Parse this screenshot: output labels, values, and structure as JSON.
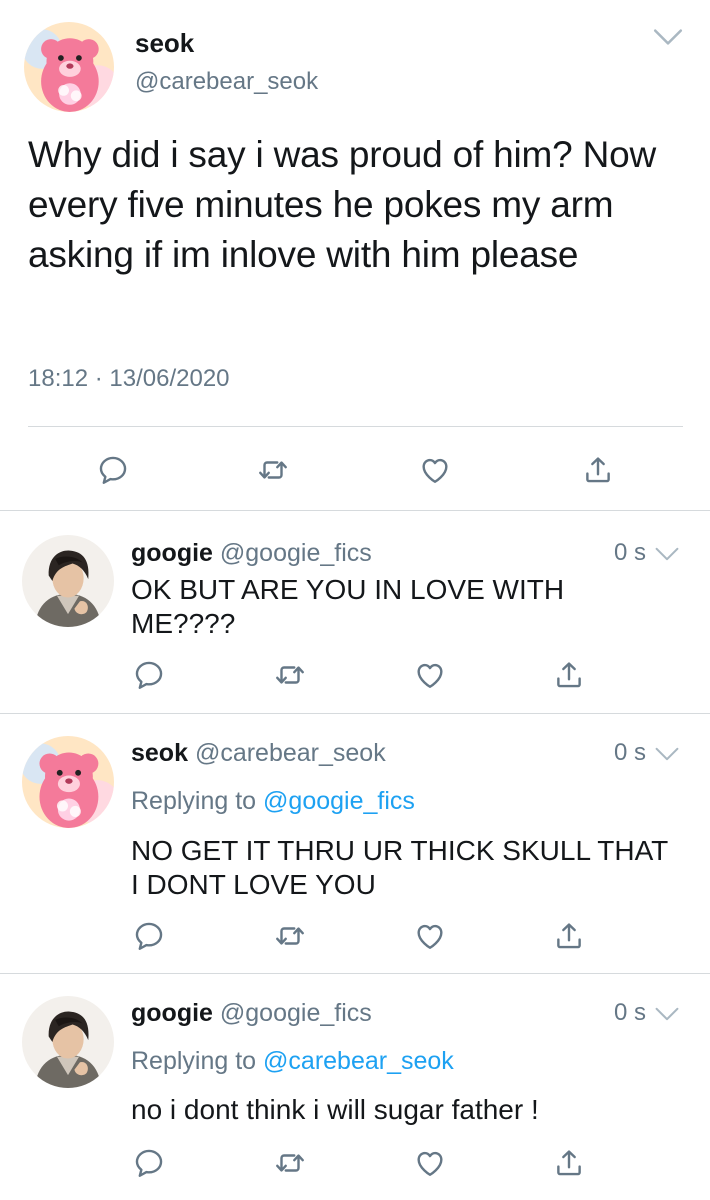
{
  "main_tweet": {
    "display_name": "seok",
    "handle": "@carebear_seok",
    "text": "Why did i say i was proud of him? Now every five minutes he pokes my arm asking if im inlove with him please",
    "time": "18:12",
    "separator": "·",
    "date": "13/06/2020",
    "avatar_icon": "pink-bear-avatar",
    "menu_icon": "chevron-down-icon"
  },
  "replies": [
    {
      "display_name": "googie",
      "handle": "@googie_fics",
      "time": "0 s",
      "replying_label": "",
      "replying_to": "",
      "text": "OK BUT ARE YOU IN LOVE WITH ME????",
      "avatar_icon": "person-avatar"
    },
    {
      "display_name": "seok",
      "handle": "@carebear_seok",
      "time": "0 s",
      "replying_label": "Replying to",
      "replying_to": "@googie_fics",
      "text": "NO GET IT THRU UR THICK SKULL THAT I DONT LOVE YOU",
      "avatar_icon": "pink-bear-avatar"
    },
    {
      "display_name": "googie",
      "handle": "@googie_fics",
      "time": "0 s",
      "replying_label": "Replying to",
      "replying_to": "@carebear_seok",
      "text": "no i dont think i will sugar father !",
      "avatar_icon": "person-avatar"
    }
  ],
  "actions": [
    "reply-icon",
    "retweet-icon",
    "like-icon",
    "share-icon"
  ],
  "colors": {
    "text": "#14171a",
    "muted": "#657786",
    "link": "#1da1f2",
    "divider": "#d6dadd",
    "bear_pink": "#f47a9a",
    "avatar_bg_pastel": "#ffe6c4"
  }
}
